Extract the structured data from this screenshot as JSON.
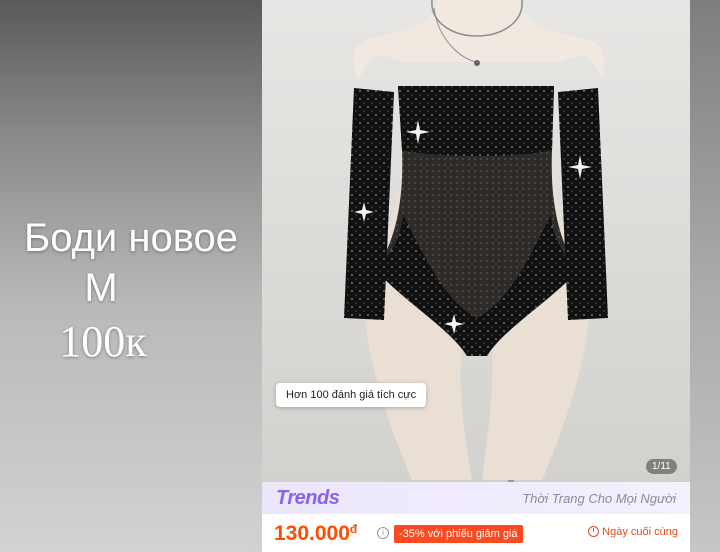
{
  "overlay": {
    "title": "Боди новое",
    "size": "М",
    "price": "100к"
  },
  "photo": {
    "review_chip": "Hơn 100 đánh giá tích cực",
    "counter": "1/11"
  },
  "trends": {
    "logo": "Trends",
    "tagline": "Thời Trang Cho Mọi Người"
  },
  "price_bar": {
    "price": "130.000",
    "currency": "đ",
    "discount": "-35% với phiếu giảm giá",
    "deadline": "Ngày cuối cùng"
  },
  "colors": {
    "accent": "#ff4d00",
    "trends_purple": "#8a63e6"
  }
}
